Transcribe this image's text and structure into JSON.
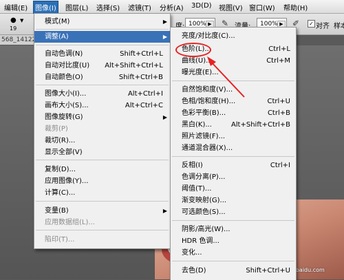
{
  "menubar": {
    "items": [
      "编辑(E)",
      "图像(I)",
      "图层(L)",
      "选择(S)",
      "滤镜(T)",
      "分析(A)",
      "3D(D)",
      "视图(V)",
      "窗口(W)",
      "帮助(H)"
    ]
  },
  "options": {
    "brush_size": "19",
    "opacity_label": "度:",
    "opacity_value": "100%",
    "flow_label": "流量:",
    "flow_value": "100%",
    "align_label": "对齐",
    "sample_label": "样本"
  },
  "document": {
    "tab_label": "568_14122"
  },
  "image_menu": {
    "items": [
      {
        "label": "模式(M)",
        "shortcut": "",
        "submenu": true,
        "disabled": false
      },
      {
        "label": "调整(A)",
        "shortcut": "",
        "submenu": true,
        "disabled": false,
        "highlighted": true
      },
      {
        "label": "自动色调(N)",
        "shortcut": "Shift+Ctrl+L"
      },
      {
        "label": "自动对比度(U)",
        "shortcut": "Alt+Shift+Ctrl+L"
      },
      {
        "label": "自动颜色(O)",
        "shortcut": "Shift+Ctrl+B"
      },
      {
        "label": "图像大小(I)...",
        "shortcut": "Alt+Ctrl+I"
      },
      {
        "label": "画布大小(S)...",
        "shortcut": "Alt+Ctrl+C"
      },
      {
        "label": "图像旋转(G)",
        "shortcut": "",
        "submenu": true
      },
      {
        "label": "裁剪(P)",
        "shortcut": "",
        "disabled": true
      },
      {
        "label": "裁切(R)...",
        "shortcut": ""
      },
      {
        "label": "显示全部(V)",
        "shortcut": ""
      },
      {
        "label": "复制(D)...",
        "shortcut": ""
      },
      {
        "label": "应用图像(Y)...",
        "shortcut": ""
      },
      {
        "label": "计算(C)...",
        "shortcut": ""
      },
      {
        "label": "变量(B)",
        "shortcut": "",
        "submenu": true
      },
      {
        "label": "应用数据组(L)...",
        "shortcut": "",
        "disabled": true
      },
      {
        "label": "陷印(T)...",
        "shortcut": "",
        "disabled": true
      }
    ]
  },
  "adjust_menu": {
    "items": [
      {
        "label": "亮度/对比度(C)...",
        "shortcut": ""
      },
      {
        "label": "色阶(L)...",
        "shortcut": "Ctrl+L"
      },
      {
        "label": "曲线(U)...",
        "shortcut": "Ctrl+M"
      },
      {
        "label": "曝光度(E)...",
        "shortcut": ""
      },
      {
        "label": "自然饱和度(V)...",
        "shortcut": ""
      },
      {
        "label": "色相/饱和度(H)...",
        "shortcut": "Ctrl+U"
      },
      {
        "label": "色彩平衡(B)...",
        "shortcut": "Ctrl+B"
      },
      {
        "label": "黑白(K)...",
        "shortcut": "Alt+Shift+Ctrl+B"
      },
      {
        "label": "照片滤镜(F)...",
        "shortcut": ""
      },
      {
        "label": "通道混合器(X)...",
        "shortcut": ""
      },
      {
        "label": "反相(I)",
        "shortcut": "Ctrl+I"
      },
      {
        "label": "色调分离(P)...",
        "shortcut": ""
      },
      {
        "label": "阈值(T)...",
        "shortcut": ""
      },
      {
        "label": "渐变映射(G)...",
        "shortcut": ""
      },
      {
        "label": "可选颜色(S)...",
        "shortcut": ""
      },
      {
        "label": "阴影/高光(W)...",
        "shortcut": ""
      },
      {
        "label": "HDR 色调...",
        "shortcut": ""
      },
      {
        "label": "变化...",
        "shortcut": ""
      },
      {
        "label": "去色(D)",
        "shortcut": "Shift+Ctrl+U"
      }
    ]
  },
  "watermark": {
    "text": "经验",
    "url": "jingyan.baidu.com"
  },
  "colors": {
    "menu_highlight": "#3a72b8",
    "annotation": "#e62222"
  }
}
